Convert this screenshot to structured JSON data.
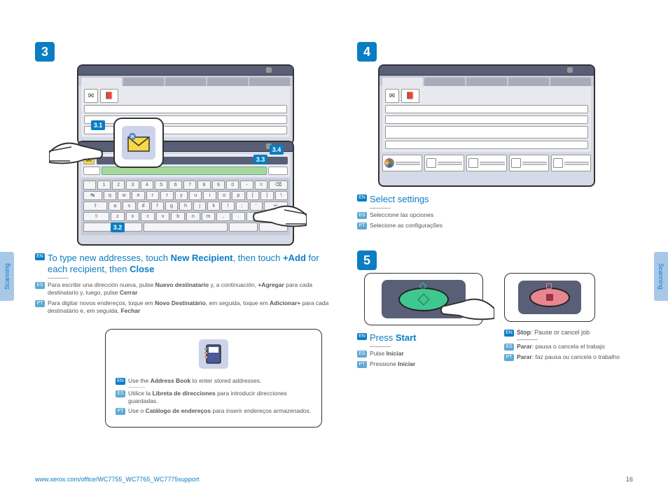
{
  "sideTab": "Scanning",
  "footer": {
    "url": "www.xerox.com/office/WC7755_WC7765_WC7775support",
    "page": "16"
  },
  "step3": {
    "num": "3",
    "sub31": "3.1",
    "sub32": "3.2",
    "sub33": "3.3",
    "sub34": "3.4",
    "en_prefix": "To type new addresses, touch ",
    "en_b1": "New Recipient",
    "en_mid": ", then touch ",
    "en_b2": "+Add",
    "en_mid2": " for each recipient, then ",
    "en_b3": "Close",
    "es_prefix": "Para escribir una dirección nueva, pulse ",
    "es_b1": "Nuevo destinatario",
    "es_mid": " y, a continuación, ",
    "es_b2": "+Agregar",
    "es_mid2": " para cada destinatario y, luego, pulse ",
    "es_b3": "Cerrar",
    "pt_prefix": "Para digitar novos endereços, toque em ",
    "pt_b1": "Novo Destinatário",
    "pt_mid": ", em seguida, toque em ",
    "pt_b2": "Adicionar+",
    "pt_mid2": " para cada destinatário e, em seguida, ",
    "pt_b3": "Fechar"
  },
  "addressBook": {
    "en_prefix": "Use the ",
    "en_b": "Address Book",
    "en_suffix": " to enter stored addresses.",
    "es_prefix": "Utilice la ",
    "es_b": "Libreta de direcciones",
    "es_suffix": " para introducir direcciones guardadas.",
    "pt_prefix": "Use o ",
    "pt_b": "Catálogo de endereços",
    "pt_suffix": " para inserir endereços armazenados."
  },
  "step4": {
    "num": "4",
    "en": "Select settings",
    "es": "Seleccione las opciones",
    "pt": "Selecione as configurações"
  },
  "step5": {
    "num": "5",
    "start_en_prefix": "Press ",
    "start_en_b": "Start",
    "start_es_prefix": "Pulse ",
    "start_es_b": "Iniciar",
    "start_pt_prefix": "Pressione ",
    "start_pt_b": "Iniciar",
    "stop_en_b": "Stop",
    "stop_en_suffix": ": Pause or cancel job",
    "stop_es_b": "Parar",
    "stop_es_suffix": ": pausa o cancela el trabajo",
    "stop_pt_b": "Parar",
    "stop_pt_suffix": ": faz pausa ou cancela o trabalho"
  },
  "keyboard": {
    "row1": [
      "`",
      "1",
      "2",
      "3",
      "4",
      "5",
      "6",
      "7",
      "8",
      "9",
      "0",
      "-",
      "="
    ],
    "row2": [
      "q",
      "w",
      "e",
      "r",
      "t",
      "y",
      "u",
      "i",
      "o",
      "p",
      "[",
      "]",
      "\\"
    ],
    "row3": [
      "a",
      "s",
      "d",
      "f",
      "g",
      "h",
      "j",
      "k",
      "l",
      ";",
      "'"
    ],
    "row4": [
      "z",
      "x",
      "c",
      "v",
      "b",
      "n",
      "m",
      ",",
      ".",
      "/"
    ]
  }
}
